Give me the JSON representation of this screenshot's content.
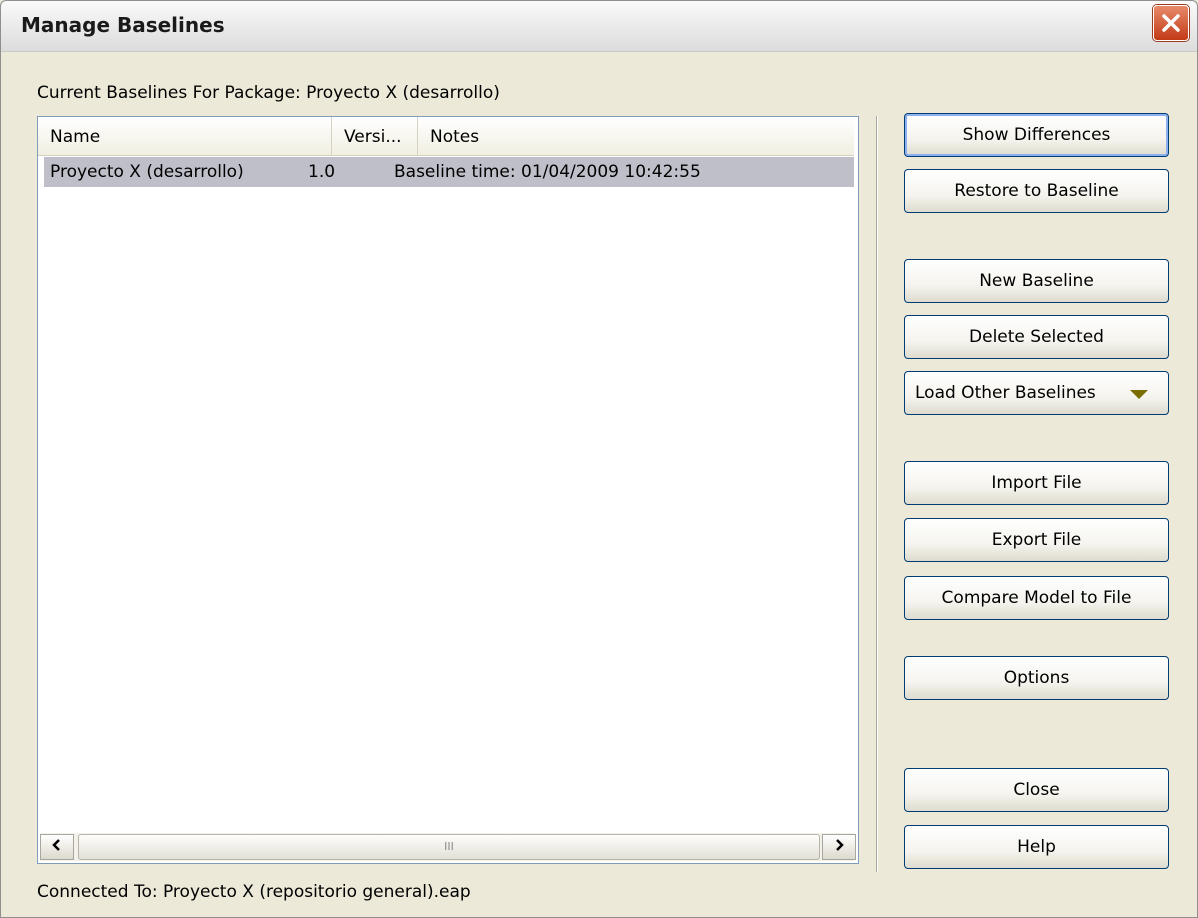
{
  "window": {
    "title": "Manage Baselines"
  },
  "package_label": "Current Baselines For Package: Proyecto X (desarrollo)",
  "list": {
    "columns": [
      "Name",
      "Versi...",
      "Notes"
    ],
    "rows": [
      {
        "name": "Proyecto X (desarrollo)",
        "version": "1.0",
        "notes": "Baseline time: 01/04/2009 10:42:55"
      }
    ]
  },
  "buttons": {
    "show_differences": "Show Differences",
    "restore": "Restore to Baseline",
    "new_baseline": "New Baseline",
    "delete_selected": "Delete Selected",
    "load_other": "Load Other Baselines",
    "import_file": "Import File",
    "export_file": "Export File",
    "compare": "Compare Model to File",
    "options": "Options",
    "close": "Close",
    "help": "Help"
  },
  "status": "Connected To: Proyecto X (repositorio general).eap",
  "scrollbar_grip": "III"
}
